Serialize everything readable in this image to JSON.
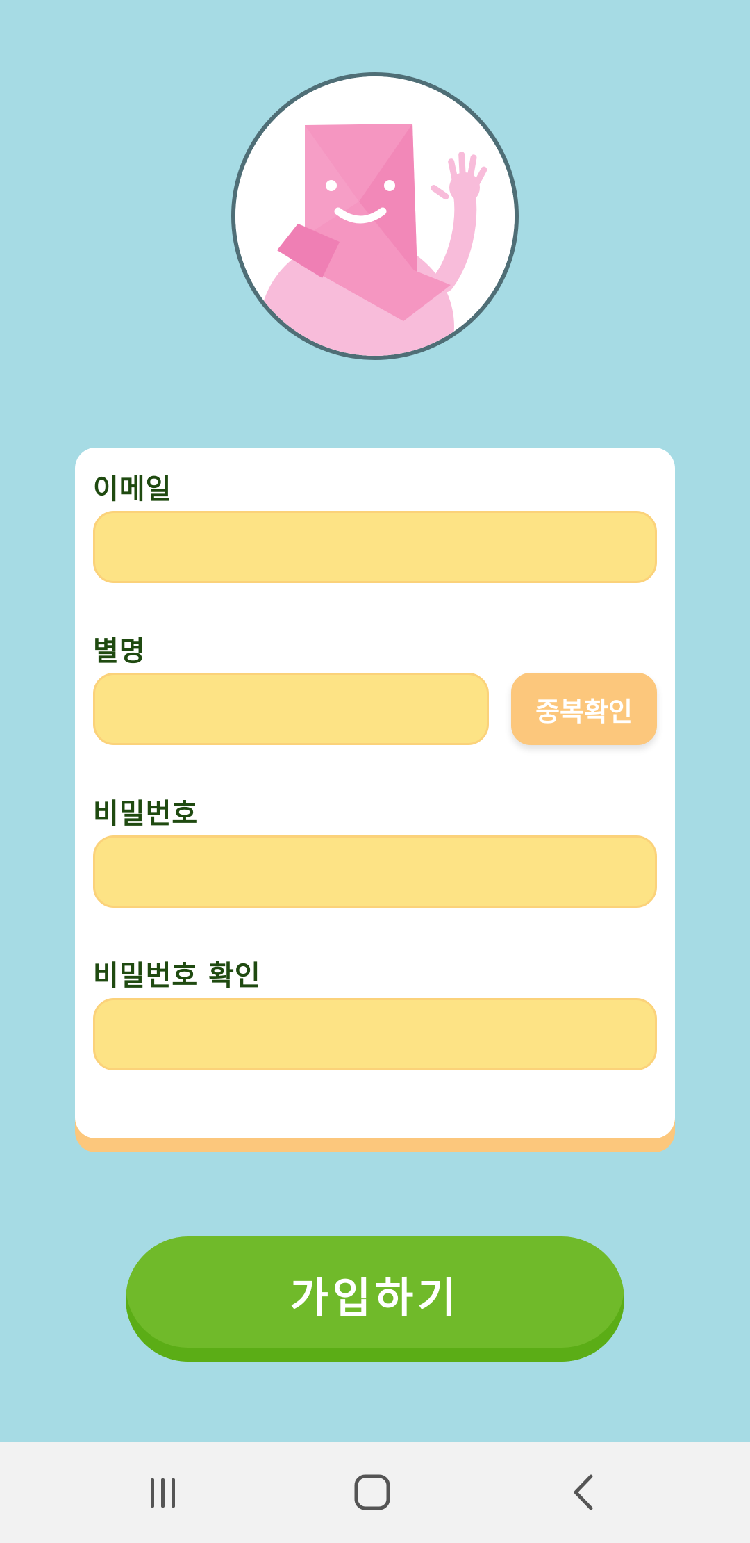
{
  "avatar": {
    "icon": "waving-envelope-mascot",
    "colors": {
      "border": "#4f6e76",
      "envelope": "#f596c1",
      "body": "#f8bcda"
    }
  },
  "form": {
    "email": {
      "label": "이메일",
      "value": "",
      "placeholder": ""
    },
    "nickname": {
      "label": "별명",
      "value": "",
      "placeholder": "",
      "check_button": "중복확인"
    },
    "password": {
      "label": "비밀번호",
      "value": "",
      "placeholder": ""
    },
    "password_confirm": {
      "label": "비밀번호 확인",
      "value": "",
      "placeholder": ""
    }
  },
  "submit": {
    "label": "가입하기"
  },
  "nav": {
    "items": [
      {
        "icon": "recent-apps-icon"
      },
      {
        "icon": "home-icon"
      },
      {
        "icon": "back-icon"
      }
    ]
  },
  "colors": {
    "background": "#a6dbe4",
    "card": "#ffffff",
    "card_shadow": "#fcc77c",
    "input_fill": "#fde385",
    "input_border": "#fbd27a",
    "label_text": "#1f4a10",
    "check_button": "#fcc77c",
    "submit_button": "#70ba2a",
    "nav_bar": "#f2f2f2"
  }
}
